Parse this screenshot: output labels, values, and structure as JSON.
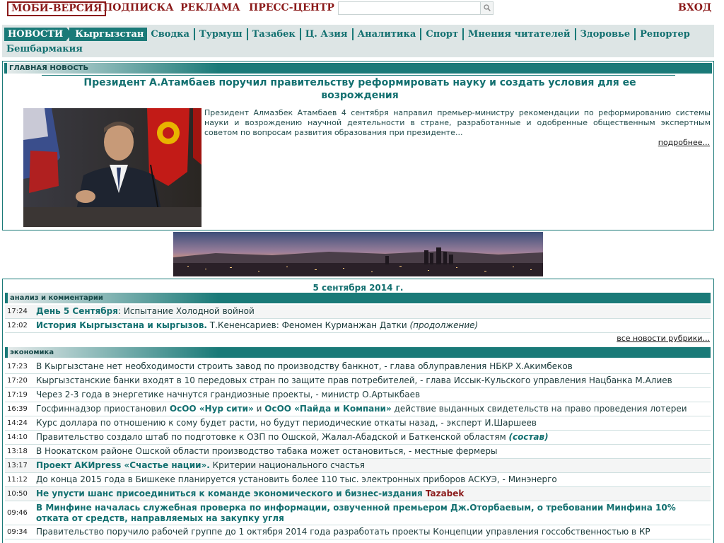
{
  "topbar": {
    "mobi": "МОБИ-ВЕРСИЯ",
    "subscribe": "ПОДПИСКА",
    "ads": "РЕКЛАМА",
    "press": "ПРЕСС-ЦЕНТР",
    "search_placeholder": "",
    "search_icon": "magnifier-icon",
    "login": "ВХОД"
  },
  "nav": {
    "news": "НОВОСТИ",
    "row1": [
      "Кыргызстан",
      "Сводка",
      "Турмуш",
      "Тазабек",
      "Ц. Азия",
      "Аналитика",
      "Спорт",
      "Мнения читателей",
      "Здоровье",
      "Репортер"
    ],
    "row2": [
      "Бешбармакия"
    ]
  },
  "main_news": {
    "section": "ГЛАВНАЯ НОВОСТЬ",
    "title": "Президент А.Атамбаев поручил правительству реформировать науку и создать условия для ее возрождения",
    "text": "Президент Алмазбек Атамбаев 4 сентября направил премьер-министру рекомендации по реформированию системы науки и возрождению научной деятельности в стране, разработанные и одобренные общественным экспертным советом по вопросам развития образования при президенте...",
    "more": "подробнее..."
  },
  "feed": {
    "date": "5 сентября 2014 г.",
    "analysis_section": "анализ и комментарии",
    "analysis": [
      {
        "time": "17:24",
        "bold": "День 5 Сентября",
        "rest": ": Испытание Холодной войной"
      },
      {
        "time": "12:02",
        "bold": "История Кыргызстана и кыргызов.",
        "rest": " Т.Кененсариев: Феномен Курманжан Датки ",
        "italic": "(продолжение)"
      }
    ],
    "all_news": "все новости рубрики...",
    "economy_section": "экономика",
    "economy": [
      {
        "time": "17:23",
        "text": "В Кыргызстане нет необходимости строить завод по производству банкнот, - глава облуправления НБКР Х.Акимбеков"
      },
      {
        "time": "17:20",
        "text": "Кыргызстанские банки входят в 10 передовых стран по защите прав потребителей, - глава Иссык-Кульского управления Нацбанка М.Алиев"
      },
      {
        "time": "17:19",
        "text": "Через 2-3 года в энергетике начнутся грандиозные проекты, - министр О.Артыкбаев"
      },
      {
        "time": "16:39",
        "p1": "Госфиннадзор приостановил ",
        "b1": "ОсОО «Нур сити»",
        "p2": " и ",
        "b2": "ОсОО «Пайда и Компани»",
        "p3": " действие выданных свидетельств на право проведения лотереи"
      },
      {
        "time": "14:24",
        "text": "Курс доллара по отношению к сому будет расти, но будут периодические откаты назад, - эксперт И.Шаршеев"
      },
      {
        "time": "14:10",
        "text": "Правительство создало штаб по подготовке к ОЗП по Ошской, Жалал-Абадской и Баткенской областям ",
        "italic": "(состав)"
      },
      {
        "time": "13:18",
        "text": "В Ноокатском районе Ошской области производство табака может остановиться, - местные фермеры"
      },
      {
        "time": "13:17",
        "bold": "Проект АКИpress «Счастье нации».",
        "rest": " Критерии национального счастья"
      },
      {
        "time": "11:12",
        "text": "До конца 2015 года в Бишкеке планируется установить более 110 тыс. электронных приборов АСКУЭ, - Минэнерго"
      },
      {
        "time": "10:50",
        "bold": "Не упусти шанс присоединиться к команде экономического и бизнес-издания ",
        "red": "Tazabek"
      },
      {
        "time": "09:46",
        "bold": "В Минфине началась служебная проверка по информации, озвученной премьером Дж.Оторбаевым, о требовании Минфина 10% отката от средств, направляемых на закупку угля"
      },
      {
        "time": "09:34",
        "text": "Правительство поручило рабочей группе до 1 октября 2014 года разработать проекты Концепции управления госсобственностью в КР"
      }
    ]
  }
}
